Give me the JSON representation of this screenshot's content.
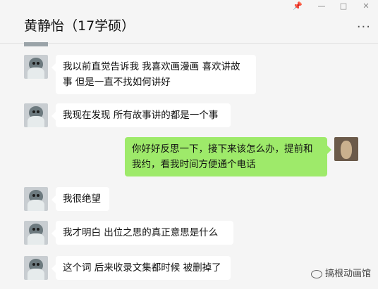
{
  "header": {
    "title": "黄静怡（17学硕）",
    "pin_icon": "pin-icon",
    "minimize_icon": "minimize-icon",
    "maximize_icon": "maximize-icon",
    "close_icon": "close-icon",
    "more_icon": "more-icon",
    "more_glyph": "···"
  },
  "messages": [
    {
      "side": "left",
      "text": "我以前直觉告诉我 我喜欢画漫画  喜欢讲故事  但是一直不找如何讲好"
    },
    {
      "side": "left",
      "text": "我现在发现 所有故事讲的都是一个事"
    },
    {
      "side": "right",
      "text": "你好好反思一下，接下来该怎么办，提前和我约，看我时间方便通个电话"
    },
    {
      "side": "left",
      "text": "我很绝望"
    },
    {
      "side": "left",
      "text": "我才明白  出位之思的真正意思是什么"
    },
    {
      "side": "left",
      "text": "这个词 后来收录文集都时候 被删掉了"
    }
  ],
  "watermark": {
    "text": "搞根动画馆",
    "icon": "wechat-icon"
  }
}
